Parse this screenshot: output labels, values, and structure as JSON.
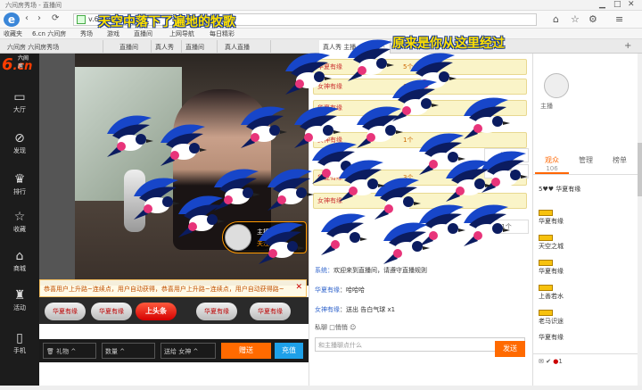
{
  "browser": {
    "title": "六间房秀场 - 直播间",
    "back_icon": "back-icon",
    "address": "v.6.cn/",
    "favbar": [
      "收藏夹",
      "6.cn 六间房",
      "秀场",
      "游戏",
      "直播间",
      "上网导航",
      "每日精彩"
    ],
    "tabs": [
      {
        "label": "六间房 六间房秀场"
      },
      {
        "label": "直播间"
      },
      {
        "label": "真人秀"
      },
      {
        "label": "直播间"
      },
      {
        "label": "真人直播"
      },
      {
        "label": "真人秀 主播"
      }
    ],
    "marquee1": "天空中落下了遍地的牧歌",
    "marquee2": "原来是你从这里经过"
  },
  "sidebar": {
    "logo": "6.cn",
    "logo_sub": "六间房",
    "items": [
      {
        "icon": "tv-icon",
        "label": "大厅"
      },
      {
        "icon": "compass-icon",
        "label": "发现"
      },
      {
        "icon": "crown-icon",
        "label": "排行"
      },
      {
        "icon": "star-icon",
        "label": "收藏"
      },
      {
        "icon": "shop-icon",
        "label": "商城"
      },
      {
        "icon": "shirt-icon",
        "label": "活动"
      },
      {
        "icon": "phone-icon",
        "label": "手机"
      }
    ]
  },
  "video": {
    "anchor_name": "主播",
    "follow": "关注"
  },
  "gift_notice": "恭喜用户上升路~连续点，用户自动获得，恭喜用户上升路~连续点，用户自动获得路~",
  "gift_pills": [
    "华夏有缘",
    "华夏有缘",
    "上头条",
    "华夏有缘",
    "华夏有缘"
  ],
  "controls": {
    "gift_label": "礼物",
    "count_label": "数量",
    "to_label": "送给",
    "to_value": "女神",
    "send_label": "赠送",
    "recharge_label": "充值"
  },
  "chat": {
    "rewards": [
      {
        "name": "华夏有缘",
        "count": "5个"
      },
      {
        "name": "女神有缘",
        "count": "6个"
      },
      {
        "name": "华夏有缘",
        "count": "4个"
      },
      {
        "name": "女神有缘",
        "count": "1个"
      },
      {
        "name": "华夏有缘",
        "count": "3个"
      },
      {
        "name": "女神有缘",
        "count": "2个"
      }
    ],
    "side_items": [
      "礼物",
      "送花",
      "1个"
    ],
    "messages": [
      {
        "user": "系统：",
        "text": "欢迎来到直播间，请遵守直播规则"
      },
      {
        "user": "华夏有缘",
        "text": "：哈哈哈"
      },
      {
        "user": "女神有缘",
        "text": "：送出 告白气球 x1"
      }
    ],
    "opts": "私聊  □悄悄  ☺",
    "input_placeholder": "和主播聊点什么",
    "send": "发送",
    "follow": "关注"
  },
  "rpanel": {
    "anchor": "主播",
    "tabs": [
      {
        "label": "观众",
        "count": "106"
      },
      {
        "label": "管理",
        "count": ""
      },
      {
        "label": "榜单",
        "count": ""
      }
    ],
    "viewers": [
      "5♥♥ 华夏有缘",
      "华夏有缘",
      "天空之城",
      "华夏有缘",
      "上善若水",
      "老马识途",
      "华夏有缘"
    ],
    "status": "1"
  },
  "colors": {
    "accent": "#ff6a00",
    "sidebar": "#1c1c1c",
    "reward_bg": "#faf4c8"
  }
}
